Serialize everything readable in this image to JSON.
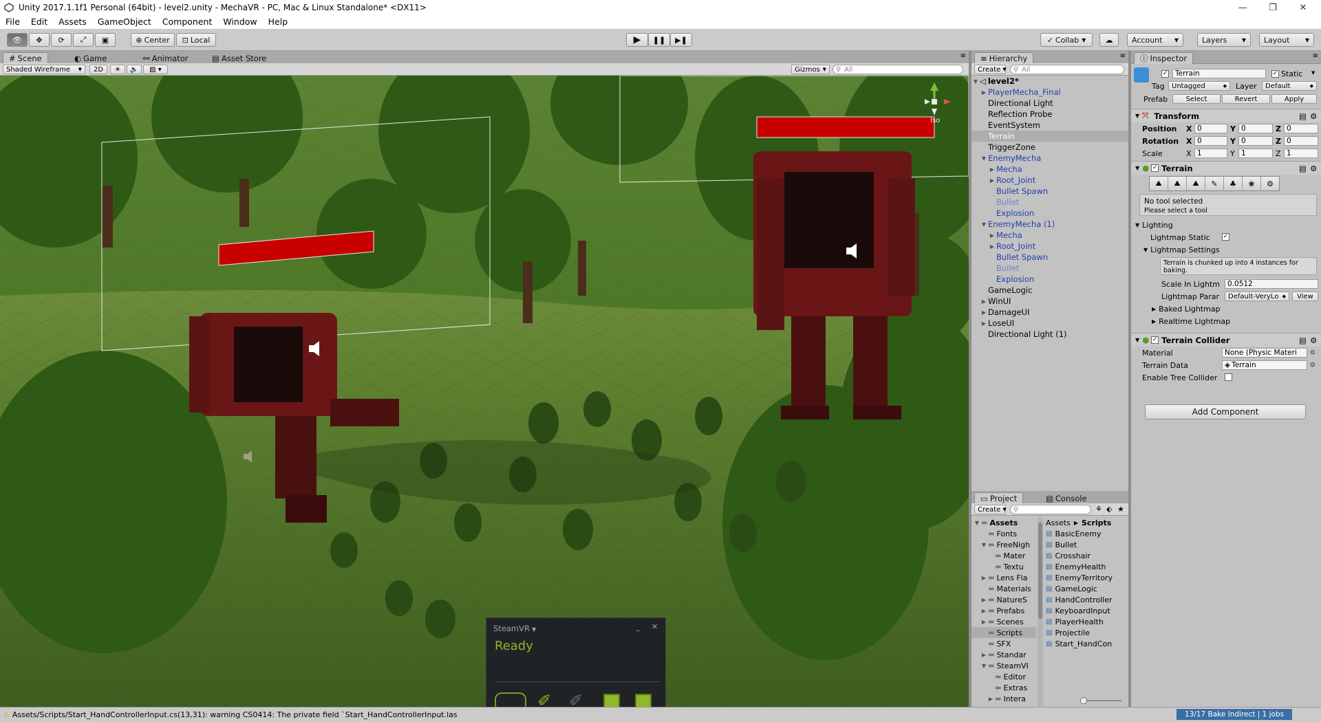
{
  "window": {
    "title": "Unity 2017.1.1f1 Personal (64bit) - level2.unity - MechaVR - PC, Mac & Linux Standalone* <DX11>",
    "minimize": "—",
    "maximize": "❐",
    "close": "✕"
  },
  "menu": [
    "File",
    "Edit",
    "Assets",
    "GameObject",
    "Component",
    "Window",
    "Help"
  ],
  "toolbar": {
    "pivot": "Center",
    "space": "Local",
    "collab": "Collab",
    "account": "Account",
    "layers": "Layers",
    "layout": "Layout"
  },
  "scene_tabs": {
    "scene": "Scene",
    "game": "Game",
    "animator": "Animator",
    "asset_store": "Asset Store"
  },
  "scene_bar": {
    "shading": "Shaded Wireframe",
    "mode2d": "2D",
    "gizmos": "Gizmos",
    "search_placeholder": "All",
    "iso": "Iso"
  },
  "hierarchy": {
    "tab": "Hierarchy",
    "create": "Create",
    "search_placeholder": "All",
    "scene": "level2*",
    "items": [
      {
        "label": "PlayerMecha_Final",
        "depth": 0,
        "arrow": "▶",
        "style": "blue"
      },
      {
        "label": "Directional Light",
        "depth": 0,
        "arrow": "",
        "style": ""
      },
      {
        "label": "Reflection Probe",
        "depth": 0,
        "arrow": "",
        "style": ""
      },
      {
        "label": "EventSystem",
        "depth": 0,
        "arrow": "",
        "style": ""
      },
      {
        "label": "Terrain",
        "depth": 0,
        "arrow": "",
        "style": "sel"
      },
      {
        "label": "TriggerZone",
        "depth": 0,
        "arrow": "",
        "style": ""
      },
      {
        "label": "EnemyMecha",
        "depth": 0,
        "arrow": "▼",
        "style": "blue"
      },
      {
        "label": "Mecha",
        "depth": 1,
        "arrow": "▶",
        "style": "blue"
      },
      {
        "label": "Root_Joint",
        "depth": 1,
        "arrow": "▶",
        "style": "blue"
      },
      {
        "label": "Bullet Spawn",
        "depth": 1,
        "arrow": "",
        "style": "blue"
      },
      {
        "label": "Bullet",
        "depth": 1,
        "arrow": "",
        "style": "dim"
      },
      {
        "label": "Explosion",
        "depth": 1,
        "arrow": "",
        "style": "blue"
      },
      {
        "label": "EnemyMecha (1)",
        "depth": 0,
        "arrow": "▼",
        "style": "blue"
      },
      {
        "label": "Mecha",
        "depth": 1,
        "arrow": "▶",
        "style": "blue"
      },
      {
        "label": "Root_Joint",
        "depth": 1,
        "arrow": "▶",
        "style": "blue"
      },
      {
        "label": "Bullet Spawn",
        "depth": 1,
        "arrow": "",
        "style": "blue"
      },
      {
        "label": "Bullet",
        "depth": 1,
        "arrow": "",
        "style": "dim"
      },
      {
        "label": "Explosion",
        "depth": 1,
        "arrow": "",
        "style": "blue"
      },
      {
        "label": "GameLogic",
        "depth": 0,
        "arrow": "",
        "style": ""
      },
      {
        "label": "WinUI",
        "depth": 0,
        "arrow": "▶",
        "style": ""
      },
      {
        "label": "DamageUI",
        "depth": 0,
        "arrow": "▶",
        "style": ""
      },
      {
        "label": "LoseUI",
        "depth": 0,
        "arrow": "▶",
        "style": ""
      },
      {
        "label": "Directional Light (1)",
        "depth": 0,
        "arrow": "",
        "style": ""
      }
    ]
  },
  "project": {
    "tab": "Project",
    "console_tab": "Console",
    "create": "Create",
    "folders": [
      {
        "label": "Assets",
        "depth": 0,
        "arrow": "▼",
        "bold": true
      },
      {
        "label": "Fonts",
        "depth": 1,
        "arrow": ""
      },
      {
        "label": "FreeNigh",
        "depth": 1,
        "arrow": "▼"
      },
      {
        "label": "Mater",
        "depth": 2,
        "arrow": ""
      },
      {
        "label": "Textu",
        "depth": 2,
        "arrow": ""
      },
      {
        "label": "Lens Fla",
        "depth": 1,
        "arrow": "▶"
      },
      {
        "label": "Materials",
        "depth": 1,
        "arrow": ""
      },
      {
        "label": "NatureS",
        "depth": 1,
        "arrow": "▶"
      },
      {
        "label": "Prefabs",
        "depth": 1,
        "arrow": "▶"
      },
      {
        "label": "Scenes",
        "depth": 1,
        "arrow": "▶"
      },
      {
        "label": "Scripts",
        "depth": 1,
        "arrow": "",
        "sel": true
      },
      {
        "label": "SFX",
        "depth": 1,
        "arrow": ""
      },
      {
        "label": "Standar",
        "depth": 1,
        "arrow": "▶"
      },
      {
        "label": "SteamVI",
        "depth": 1,
        "arrow": "▼"
      },
      {
        "label": "Editor",
        "depth": 2,
        "arrow": ""
      },
      {
        "label": "Extras",
        "depth": 2,
        "arrow": ""
      },
      {
        "label": "Intera",
        "depth": 2,
        "arrow": "▶"
      },
      {
        "label": "Mater",
        "depth": 2,
        "arrow": ""
      }
    ],
    "breadcrumb": [
      "Assets",
      "Scripts"
    ],
    "files": [
      "BasicEnemy",
      "Bullet",
      "Crosshair",
      "EnemyHealth",
      "EnemyTerritory",
      "GameLogic",
      "HandController",
      "KeyboardInput",
      "PlayerHealth",
      "Projectile",
      "Start_HandCon"
    ]
  },
  "inspector": {
    "tab": "Inspector",
    "name": "Terrain",
    "static_label": "Static",
    "tag_label": "Tag",
    "tag": "Untagged",
    "layer_label": "Layer",
    "layer": "Default",
    "prefab_label": "Prefab",
    "select": "Select",
    "revert": "Revert",
    "apply": "Apply",
    "transform": {
      "header": "Transform",
      "position": "Position",
      "rotation": "Rotation",
      "scale": "Scale",
      "x": "X",
      "y": "Y",
      "z": "Z",
      "pos": [
        "0",
        "0",
        "0"
      ],
      "rot": [
        "0",
        "0",
        "0"
      ],
      "scl": [
        "1",
        "1",
        "1"
      ]
    },
    "terrain": {
      "header": "Terrain",
      "no_tool": "No tool selected",
      "select_tool": "Please select a tool",
      "lighting": "Lighting",
      "lightmap_static": "Lightmap Static",
      "lightmap_settings": "Lightmap Settings",
      "info": "Terrain is chunked up into 4 instances for baking.",
      "scale_label": "Scale In Lightm",
      "scale_value": "0.0512",
      "params_label": "Lightmap Parar",
      "params_value": "Default-VeryLo",
      "view": "View",
      "baked": "Baked Lightmap",
      "realtime": "Realtime Lightmap"
    },
    "collider": {
      "header": "Terrain Collider",
      "material_label": "Material",
      "material_value": "None (Physic Materi",
      "data_label": "Terrain Data",
      "data_value": "Terrain",
      "tree_label": "Enable Tree Collider"
    },
    "add_component": "Add Component"
  },
  "steamvr": {
    "title": "SteamVR",
    "status": "Ready",
    "minimize": "_",
    "close": "✕"
  },
  "status": {
    "message": "Assets/Scripts/Start_HandControllerInput.cs(13,31): warning CS0414: The private field `Start_HandControllerInput.las",
    "bake": "13/17 Bake Indirect | 1 jobs"
  },
  "colors": {
    "accent_blue": "#1e3fa8",
    "health_bar": "#c80000",
    "steam_green": "#8fb82a"
  }
}
